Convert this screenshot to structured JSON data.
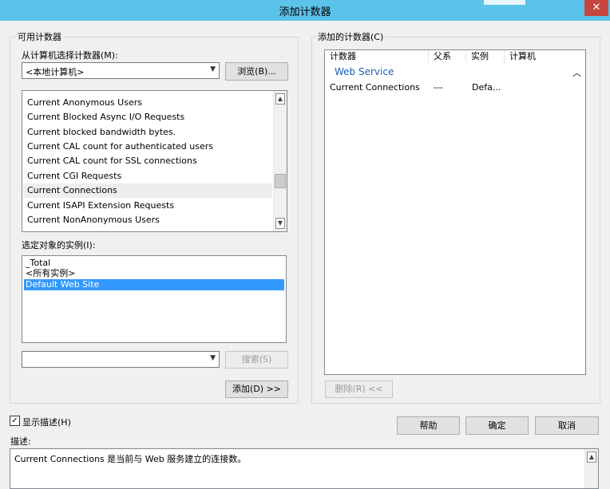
{
  "window": {
    "title": "添加计数器",
    "close_glyph": "✕"
  },
  "available": {
    "group_label": "可用计数器",
    "select_from_label": "从计算机选择计数器(M):",
    "computer_value": "<本地计算机>",
    "browse_label": "浏览(B)...",
    "counters": [
      "Current Anonymous Users",
      "Current Blocked Async I/O Requests",
      "Current blocked bandwidth bytes.",
      "Current CAL count for authenticated users",
      "Current CAL count for SSL connections",
      "Current CGI Requests",
      "Current Connections",
      "Current ISAPI Extension Requests",
      "Current NonAnonymous Users"
    ],
    "instances_label": "选定对象的实例(I):",
    "instances": [
      "_Total",
      "<所有实例>",
      "Default Web Site"
    ],
    "search_value": "",
    "search_label": "搜索(S)",
    "add_label": "添加(D) >>"
  },
  "added": {
    "group_label": "添加的计数器(C)",
    "columns": [
      "计数器",
      "父系",
      "实例",
      "计算机"
    ],
    "group_name": "Web Service",
    "rows": [
      {
        "counter": "Current Connections",
        "parent": "---",
        "instance": "Defa...",
        "computer": ""
      }
    ],
    "remove_label": "删除(R) <<"
  },
  "bottom": {
    "show_desc_label": "显示描述(H)",
    "show_desc_checked": true,
    "check_glyph": "✓",
    "help_label": "帮助",
    "ok_label": "确定",
    "cancel_label": "取消",
    "desc_label": "描述:",
    "desc_text": "Current Connections 是当前与 Web 服务建立的连接数。"
  },
  "colors": {
    "titlebar": "#5bc2ea",
    "selection": "#3399ff",
    "group_link": "#1a5fb4"
  }
}
